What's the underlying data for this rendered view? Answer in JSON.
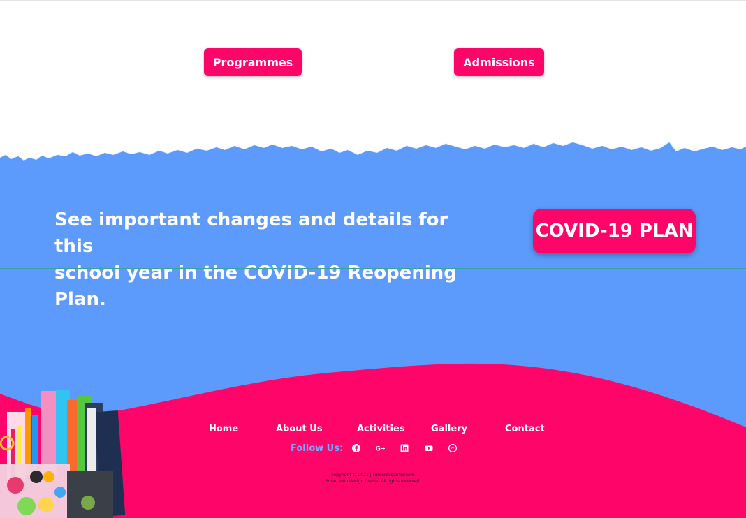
{
  "top_buttons": {
    "programmes": "Programmes",
    "admissions": "Admissions"
  },
  "hero": {
    "line1": "See important changes and details for this",
    "line2": "school year in the COVID-19 Reopening Plan.",
    "cta": "COVID-19 PLAN"
  },
  "footer": {
    "nav": [
      "Home",
      "About Us",
      "Activities",
      "Gallery",
      "Contact"
    ],
    "follow_label": "Follow Us:",
    "social_icons": [
      "facebook-icon",
      "google-plus-icon",
      "linkedin-icon",
      "youtube-icon",
      "messenger-icon"
    ],
    "copyright": "copyright © 2021 | smoorevolarter.com",
    "theme_note": "Smart web design theme. All rights reserved."
  },
  "colors": {
    "accent_pink": "#fe056a",
    "section_blue": "#5b9bfb",
    "follow_blue": "#7aa9ff",
    "white": "#ffffff"
  }
}
